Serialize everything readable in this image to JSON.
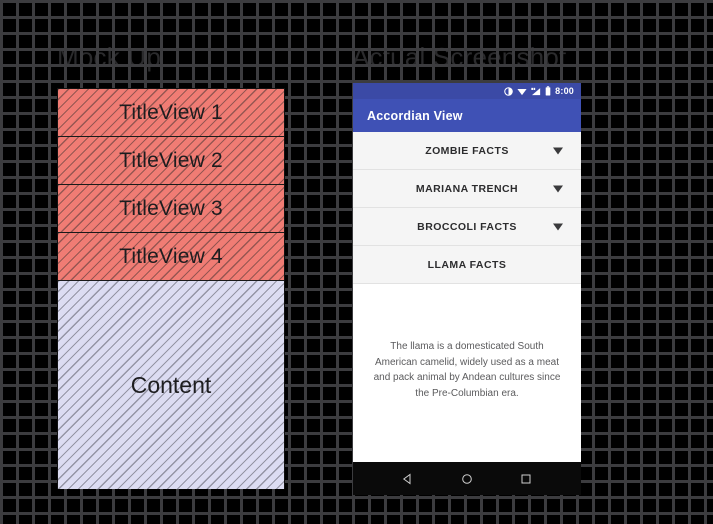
{
  "captions": {
    "mockup": "Mock Up",
    "actual": "Actual Screenshot"
  },
  "colors": {
    "background": "#000000",
    "grid_line": "#3c3c3f",
    "caption_text": "#2b2b2d",
    "titleview_fill": "#f07c74",
    "content_fill": "#dcdcf2",
    "app_bar": "#3f51b5",
    "status_bar": "#3b4aa6",
    "row_fill": "#f5f5f5",
    "nav_bar": "#0a0a0a"
  },
  "mockup": {
    "title_rows": [
      {
        "label": "TitleView 1"
      },
      {
        "label": "TitleView 2"
      },
      {
        "label": "TitleView 3"
      },
      {
        "label": "TitleView 4"
      }
    ],
    "content": {
      "label": "Content"
    }
  },
  "phone": {
    "status_bar": {
      "time": "8:00",
      "icons": [
        "alarm-icon",
        "wifi-icon",
        "signal-icon",
        "battery-icon"
      ]
    },
    "app_bar": {
      "title": "Accordian View"
    },
    "accordion": {
      "items": [
        {
          "label": "ZOMBIE FACTS",
          "expanded": false,
          "chevron": "chevron-down-icon"
        },
        {
          "label": "MARIANA TRENCH",
          "expanded": false,
          "chevron": "chevron-down-icon"
        },
        {
          "label": "BROCCOLI FACTS",
          "expanded": false,
          "chevron": "chevron-down-icon"
        },
        {
          "label": "LLAMA FACTS",
          "expanded": true,
          "chevron": ""
        }
      ],
      "expanded_body": "The llama is a domesticated South American camelid, widely used as a meat and pack animal by Andean cultures since the Pre-Columbian era."
    },
    "nav_bar": {
      "buttons": [
        "back-icon",
        "home-icon",
        "recents-icon"
      ]
    }
  }
}
